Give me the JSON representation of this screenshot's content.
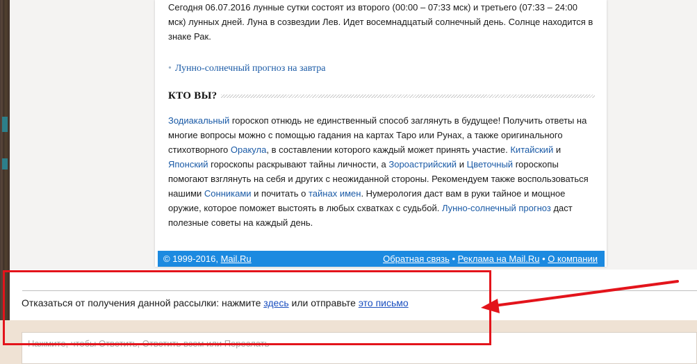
{
  "email": {
    "moon_paragraph": "Сегодня 06.07.2016 лунные сутки состоят из второго (00:00 – 07:33 мск) и третьего (07:33 – 24:00 мск) лунных дней. Луна в созвездии Лев. Идет восемнадцатый солнечный день. Солнце находится в знаке Рак.",
    "forecast_link": "Лунно-солнечный прогноз на завтра",
    "section_heading": "КТО ВЫ?",
    "body_parts": [
      {
        "text": "Зодиакальный",
        "link": true
      },
      {
        "text": " гороскоп отнюдь не единственный способ заглянуть в будущее! Получить ответы на многие вопросы можно с помощью гадания на картах Таро или Рунах, а также оригинального стихотворного ",
        "link": false
      },
      {
        "text": "Оракула",
        "link": true
      },
      {
        "text": ", в составлении которого каждый может принять участие. ",
        "link": false
      },
      {
        "text": "Китайский",
        "link": true
      },
      {
        "text": " и ",
        "link": false
      },
      {
        "text": "Японский",
        "link": true
      },
      {
        "text": " гороскопы раскрывают тайны личности, а ",
        "link": false
      },
      {
        "text": "Зороастрийский",
        "link": true
      },
      {
        "text": " и ",
        "link": false
      },
      {
        "text": "Цветочный",
        "link": true
      },
      {
        "text": " гороскопы помогают взглянуть на себя и других с неожиданной стороны. Рекомендуем также воспользоваться нашими ",
        "link": false
      },
      {
        "text": "Сонниками",
        "link": true
      },
      {
        "text": " и почитать о ",
        "link": false
      },
      {
        "text": "тайнах имен",
        "link": true
      },
      {
        "text": ". Нумерология даст вам в руки тайное и мощное оружие, которое поможет выстоять в любых схватках с судьбой. ",
        "link": false
      },
      {
        "text": "Лунно-солнечный прогноз",
        "link": true
      },
      {
        "text": " даст полезные советы на каждый день.",
        "link": false
      }
    ],
    "footer": {
      "copyright": "© 1999-2016, ",
      "company_link": "Mail.Ru",
      "feedback_link": "Обратная связь",
      "ads_link": "Реклама на Mail.Ru",
      "about_link": "О компании",
      "separator": " • "
    }
  },
  "unsubscribe": {
    "text_before": "Отказаться от получения данной рассылки: нажмите ",
    "link_here": "здесь",
    "text_middle": " или отправьте ",
    "link_letter": "это письмо"
  },
  "reply": {
    "placeholder": "Нажмите, чтобы Ответить, Ответить всем или Переслать"
  },
  "annotation": {
    "color": "#e3141b"
  },
  "colors": {
    "link": "#1a5aa6",
    "footer_bg": "#1c8ae0",
    "reply_bg": "#efe2d4"
  }
}
